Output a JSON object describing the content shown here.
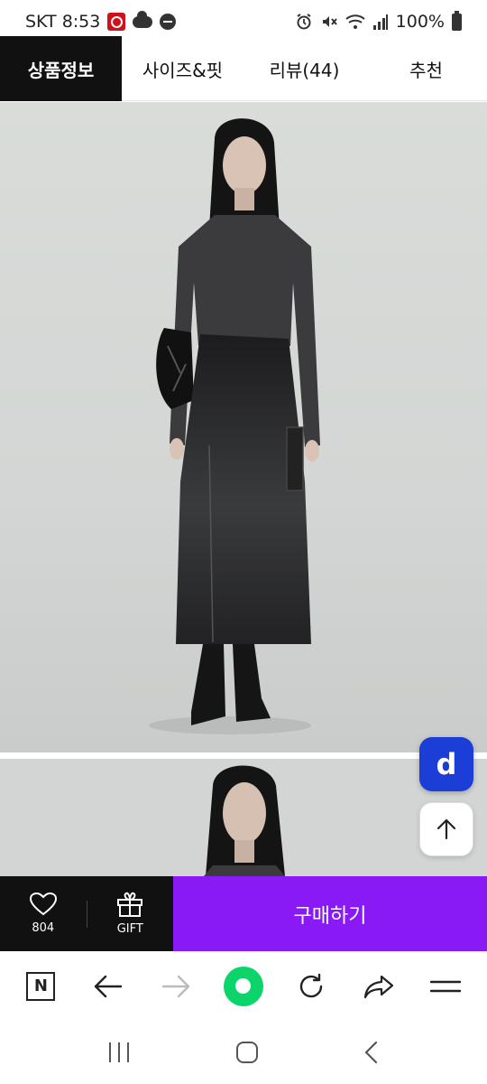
{
  "status_bar": {
    "carrier_time": "SKT 8:53",
    "battery": "100%",
    "icons": [
      "app-icon",
      "cloud-icon",
      "dnd-icon",
      "alarm-icon",
      "mute-icon",
      "wifi-icon",
      "signal-icon",
      "battery-icon"
    ]
  },
  "tabs": [
    {
      "label": "상품정보",
      "active": true
    },
    {
      "label": "사이즈&핏",
      "active": false
    },
    {
      "label": "리뷰(44)",
      "active": false
    },
    {
      "label": "추천",
      "active": false
    }
  ],
  "floating": {
    "d_label": "d",
    "top_icon": "arrow-up-icon"
  },
  "buybar": {
    "like_count": "804",
    "gift_label": "GIFT",
    "buy_label": "구매하기"
  },
  "browser": {
    "n_label": "N",
    "icons": [
      "naver-n-icon",
      "back-arrow-icon",
      "forward-arrow-icon",
      "green-home-icon",
      "reload-icon",
      "share-icon",
      "menu-icon"
    ]
  },
  "colors": {
    "tab_active_bg": "#111111",
    "buy_button": "#8a1af5",
    "d_button": "#1b3fd6",
    "home_green": "#0bd46b"
  }
}
